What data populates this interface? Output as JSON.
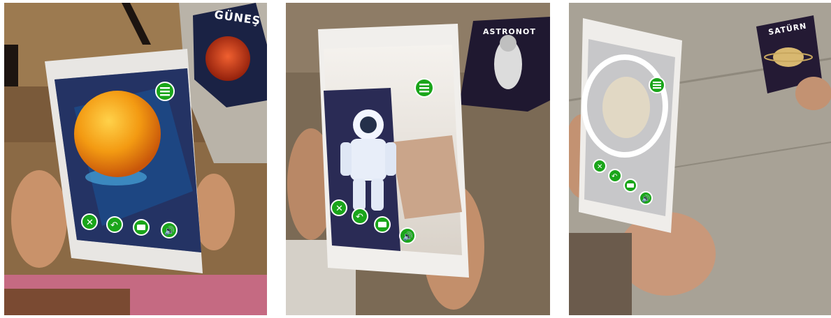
{
  "photos": [
    {
      "card_label": "GÜNEŞ",
      "subject": "sun-model"
    },
    {
      "card_label": "ASTRONOT",
      "subject": "astronaut-model"
    },
    {
      "card_label": "SATÜRN",
      "subject": "saturn-model"
    }
  ],
  "ar_app": {
    "accent_color": "#1aa51a",
    "buttons": [
      "menu-icon",
      "close-icon",
      "undo-icon",
      "camera-icon",
      "sound-icon"
    ]
  }
}
